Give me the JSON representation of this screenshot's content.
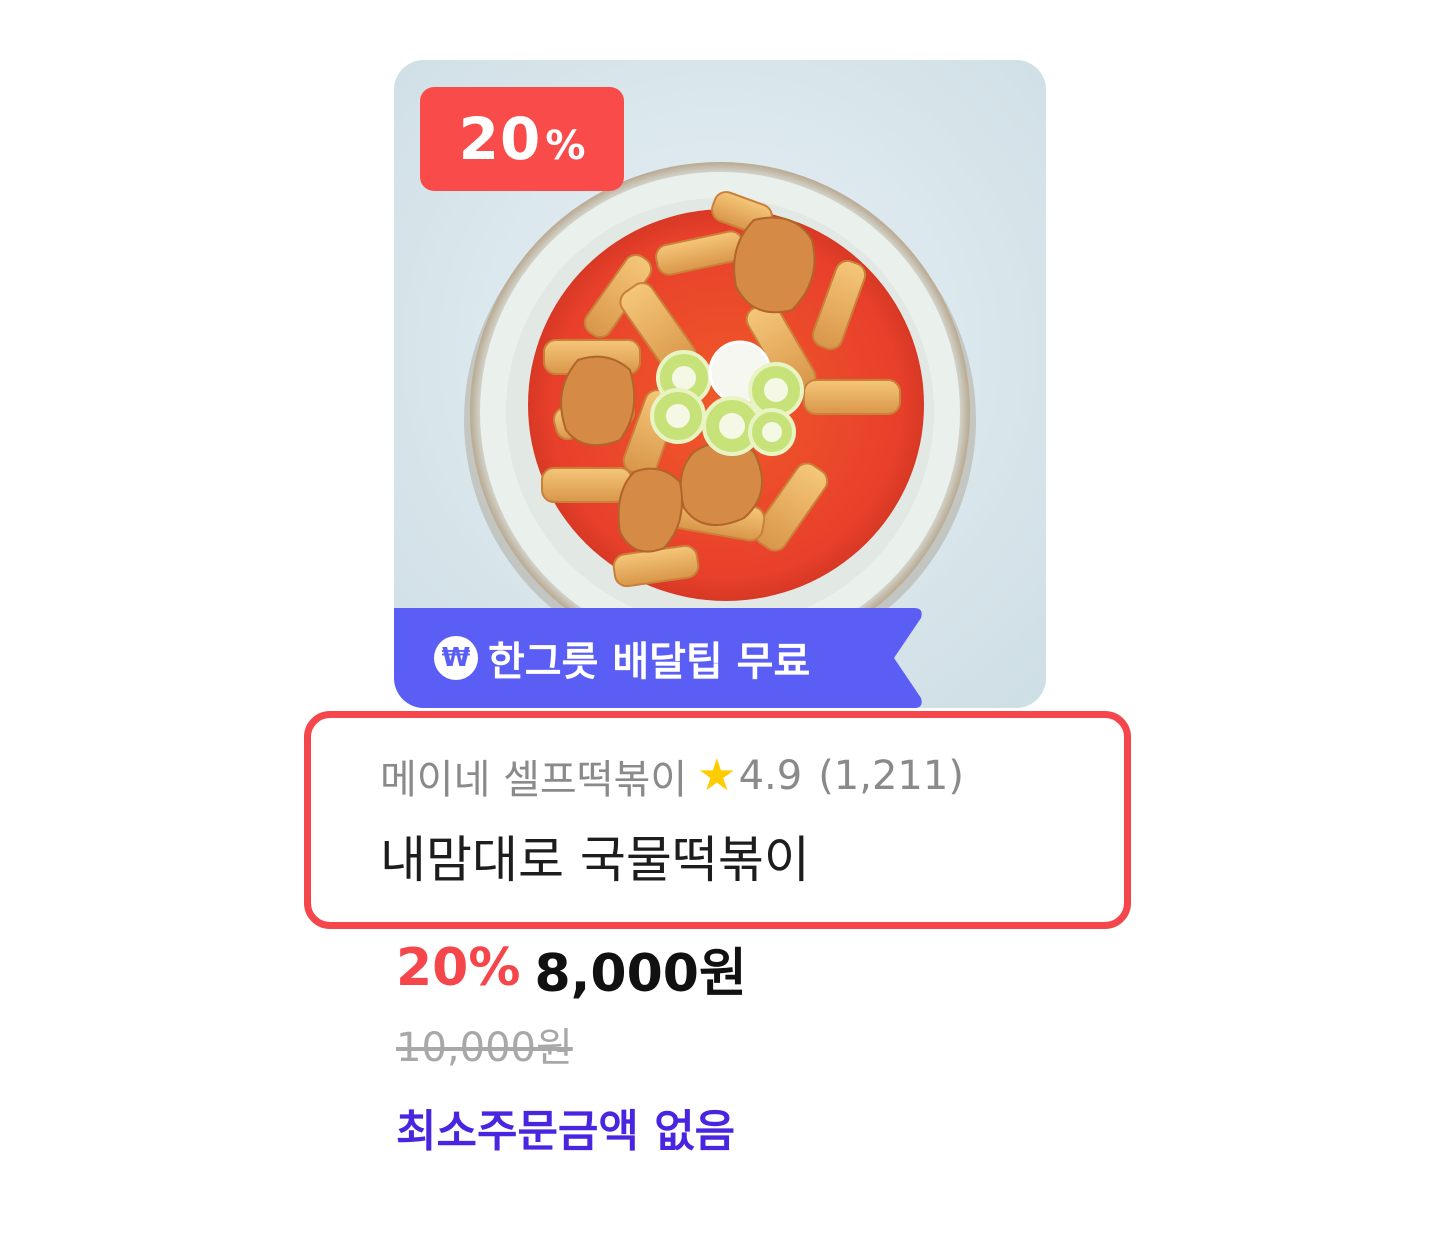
{
  "product_card": {
    "discount_badge": {
      "value": "20",
      "unit": "%"
    },
    "delivery_ribbon": {
      "icon": "won-coin-icon",
      "icon_glyph": "₩",
      "text": "한그릇 배달팁 무료"
    },
    "store": {
      "name": "메이네 셀프떡볶이",
      "star_icon": "★",
      "rating": "4.9",
      "review_count": "(1,211)"
    },
    "product_name": "내맘대로 국물떡볶이",
    "price": {
      "discount_rate": "20%",
      "final_price": "8,000원",
      "original_price": "10,000원"
    },
    "min_order_text": "최소주문금액 없음"
  },
  "colors": {
    "discount_red": "#fa4b4b",
    "ribbon_purple": "#5b5ef4",
    "highlight_border": "#f5474b",
    "min_order_purple": "#4a25e0",
    "star_yellow": "#ffcc00"
  }
}
